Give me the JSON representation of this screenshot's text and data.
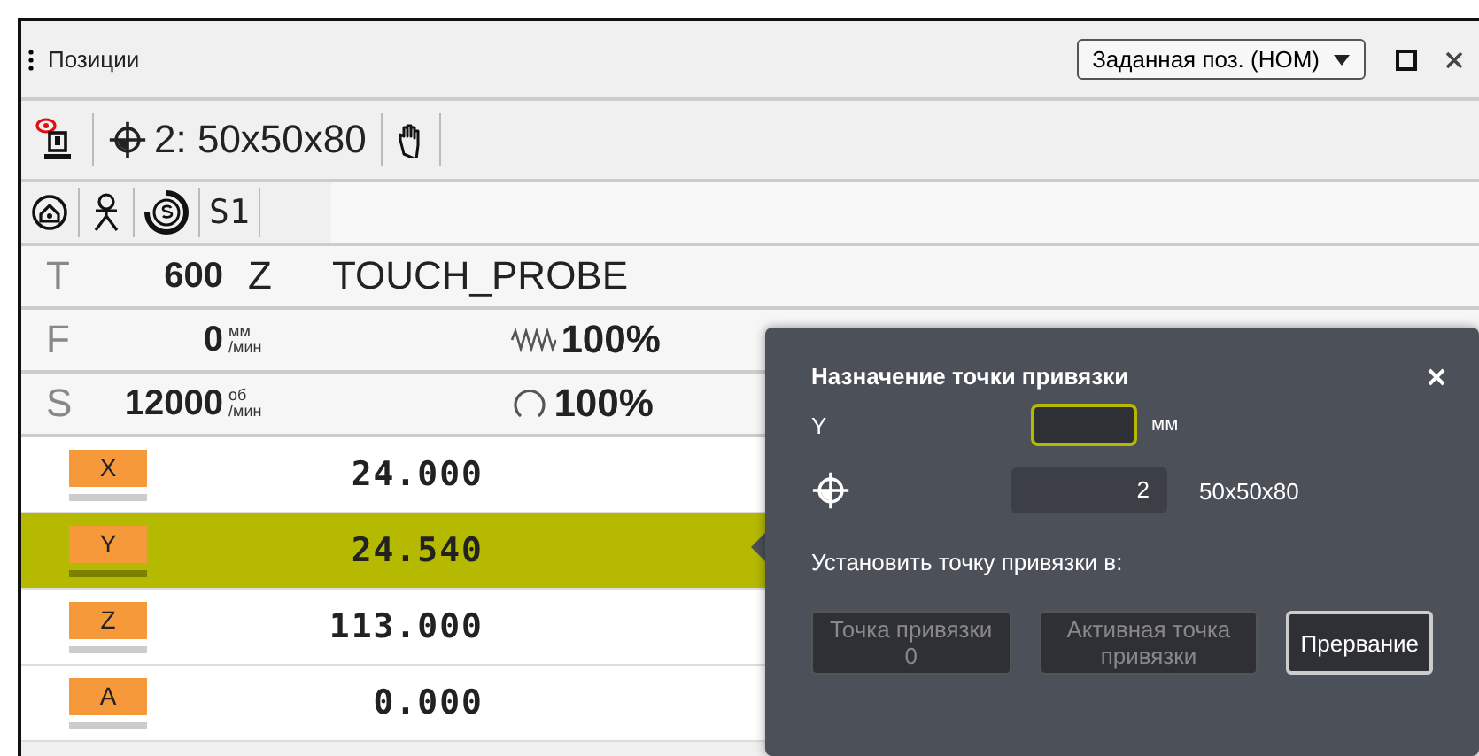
{
  "window": {
    "title": "Позиции",
    "view_select": "Заданная поз. (НОМ)"
  },
  "toolbar": {
    "preset": "2: 50x50x80"
  },
  "status_icons_row": {
    "spindle": "S1"
  },
  "tool_row": {
    "letter": "T",
    "number": "600",
    "axis": "Z",
    "name": "TOUCH_PROBE"
  },
  "feed_row": {
    "letter": "F",
    "value": "0",
    "unit_top": "мм",
    "unit_bottom": "/мин",
    "override": "100%"
  },
  "spindle_row": {
    "letter": "S",
    "value": "12000",
    "unit_top": "об",
    "unit_bottom": "/мин",
    "override": "100%"
  },
  "axes": [
    {
      "name": "X",
      "value": "24.000",
      "selected": false
    },
    {
      "name": "Y",
      "value": "24.540",
      "selected": true
    },
    {
      "name": "Z",
      "value": "113.000",
      "selected": false
    },
    {
      "name": "A",
      "value": "0.000",
      "selected": false
    }
  ],
  "dialog": {
    "title": "Назначение точки привязки",
    "axis": "Y",
    "input_unit": "мм",
    "preset_number": "2",
    "preset_name": "50x50x80",
    "prompt": "Установить точку привязки в:",
    "buttons": [
      {
        "label": "Точка привязки 0",
        "disabled": true
      },
      {
        "label": "Активная точка привязки",
        "disabled": true
      },
      {
        "label": "Прервание",
        "disabled": false
      }
    ]
  }
}
